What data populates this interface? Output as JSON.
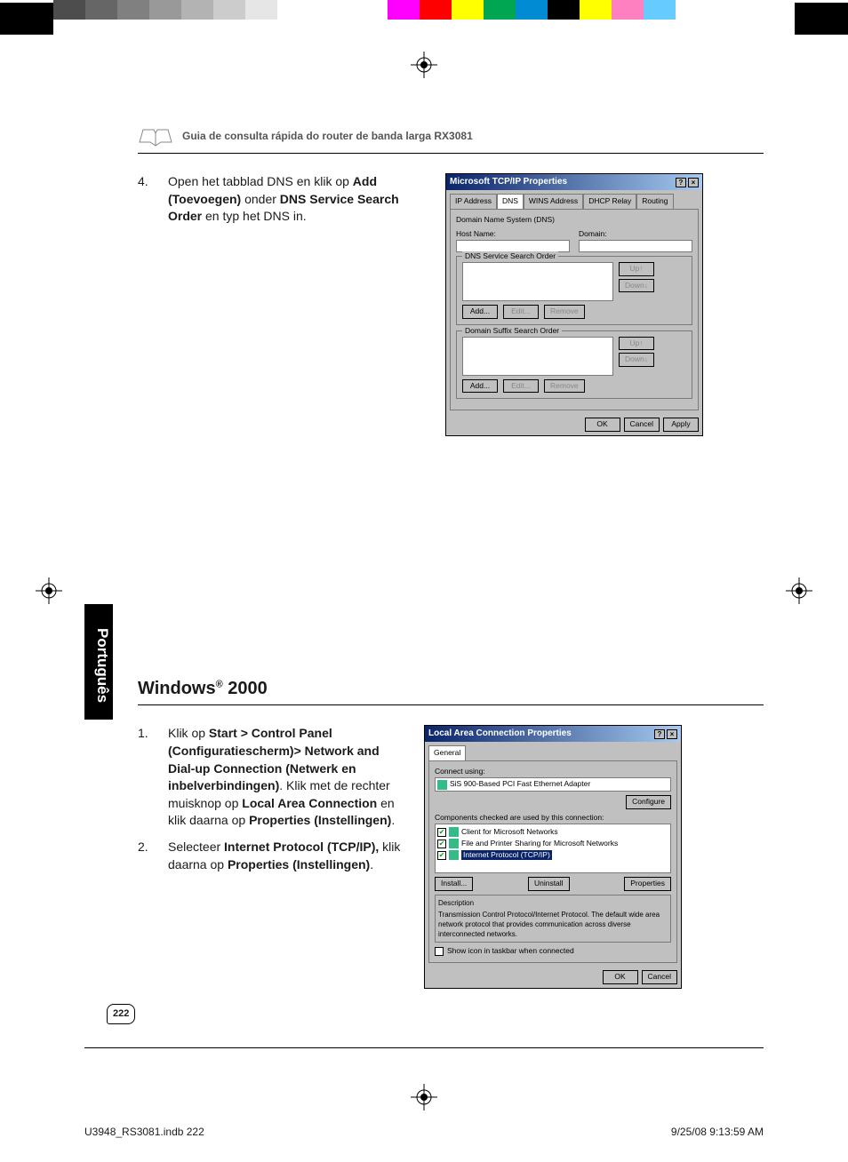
{
  "header_title": "Guia de consulta rápida do router de banda larga RX3081",
  "step4": {
    "num": "4.",
    "pre": "Open het tabblad DNS en klik op ",
    "b1": "Add (Toevoegen)",
    "mid": " onder ",
    "b2": "DNS Service Search Order",
    "post": " en typ het DNS in."
  },
  "section_title_a": "Windows",
  "section_title_b": " 2000",
  "step1": {
    "num": "1.",
    "p1": "Klik op ",
    "b1": "Start > Control Panel (Configuratiescherm)> Network and Dial-up Connection (Netwerk en inbelverbindingen)",
    "p2": ". Klik met de rechter muisknop op ",
    "b2": "Local Area Connection",
    "p3": " en klik daarna op ",
    "b3": "Properties (Instellingen)",
    "p4": "."
  },
  "step2": {
    "num": "2.",
    "p1": "Selecteer ",
    "b1": "Internet Protocol (TCP/IP),",
    "p2": " klik daarna op ",
    "b2": "Properties (Instellingen)",
    "p3": "."
  },
  "lang_tab": "Português",
  "page_num": "222",
  "slug_left": "U3948_RS3081.indb   222",
  "slug_right": "9/25/08   9:13:59 AM",
  "dlg1": {
    "title": "Microsoft TCP/IP Properties",
    "help": "?",
    "close": "×",
    "tabs": [
      "IP Address",
      "DNS",
      "WINS Address",
      "DHCP Relay",
      "Routing"
    ],
    "group_dns": "Domain Name System (DNS)",
    "host": "Host Name:",
    "domain": "Domain:",
    "group_order": "DNS Service Search Order",
    "group_suffix": "Domain Suffix Search Order",
    "up": "Up↑",
    "down": "Down↓",
    "add": "Add...",
    "edit": "Edit...",
    "remove": "Remove",
    "ok": "OK",
    "cancel": "Cancel",
    "apply": "Apply"
  },
  "dlg2": {
    "title": "Local Area Connection Properties",
    "help": "?",
    "close": "×",
    "tab": "General",
    "connect_using": "Connect using:",
    "adapter": "SiS 900-Based PCI Fast Ethernet Adapter",
    "configure": "Configure",
    "components_caption": "Components checked are used by this connection:",
    "items": [
      "Client for Microsoft Networks",
      "File and Printer Sharing for Microsoft Networks",
      "Internet Protocol (TCP/IP)"
    ],
    "install": "Install...",
    "uninstall": "Uninstall",
    "properties": "Properties",
    "desc_title": "Description",
    "desc_text": "Transmission Control Protocol/Internet Protocol. The default wide area network protocol that provides communication across diverse interconnected networks.",
    "show_icon": "Show icon in taskbar when connected",
    "ok": "OK",
    "cancel": "Cancel"
  },
  "swatches_left": [
    "#4d4d4d",
    "#666666",
    "#808080",
    "#999999",
    "#b3b3b3",
    "#cccccc",
    "#e6e6e6",
    "#ffffff"
  ],
  "swatches_right": [
    "#ff00ff",
    "#ff0000",
    "#ffff00",
    "#00a651",
    "#008bd2",
    "#000000",
    "#ffff00",
    "#ff80c0",
    "#66ccff"
  ]
}
